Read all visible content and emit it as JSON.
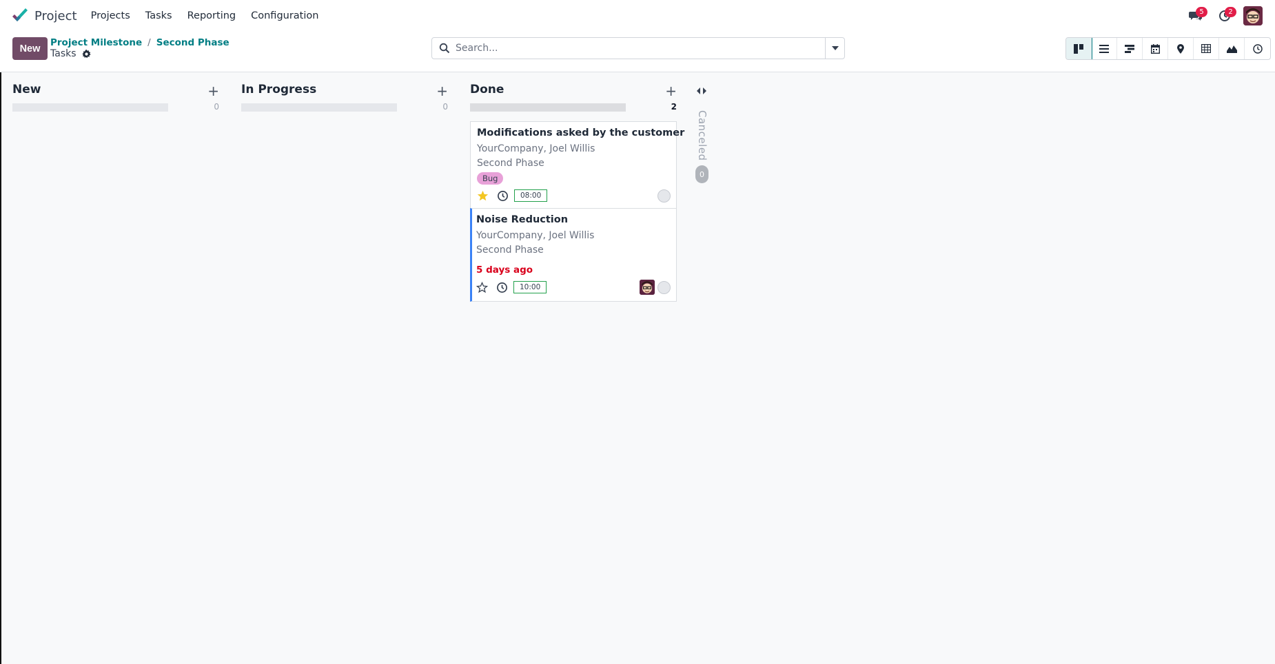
{
  "app": {
    "name": "Project"
  },
  "menu": [
    "Projects",
    "Tasks",
    "Reporting",
    "Configuration"
  ],
  "systray": {
    "messages_count": "5",
    "activities_count": "2"
  },
  "control": {
    "new_label": "New",
    "breadcrumb": [
      "Project Milestone",
      "Second Phase"
    ],
    "current": "Tasks",
    "search_placeholder": "Search..."
  },
  "views": [
    "kanban-icon",
    "list-icon",
    "gantt-icon",
    "calendar-icon",
    "map-pin-icon",
    "pivot-icon",
    "graph-icon",
    "activity-icon"
  ],
  "columns": [
    {
      "title": "New",
      "count": "0"
    },
    {
      "title": "In Progress",
      "count": "0"
    },
    {
      "title": "Done",
      "count": "2"
    }
  ],
  "folded_column": {
    "title": "Canceled",
    "count": "0"
  },
  "cards": [
    {
      "title": "Modifications asked by the customer",
      "company": "YourCompany, Joel Willis",
      "milestone": "Second Phase",
      "tag": "Bug",
      "time": "08:00",
      "starred": true
    },
    {
      "title": "Noise Reduction",
      "company": "YourCompany, Joel Willis",
      "milestone": "Second Phase",
      "deadline": "5 days ago",
      "time": "10:00",
      "starred": false
    }
  ],
  "colors": {
    "brand": "#714b67",
    "link": "#017e84",
    "deadline": "#d9001b",
    "tag": "#e8a1d8",
    "badge": "#e11d48"
  }
}
